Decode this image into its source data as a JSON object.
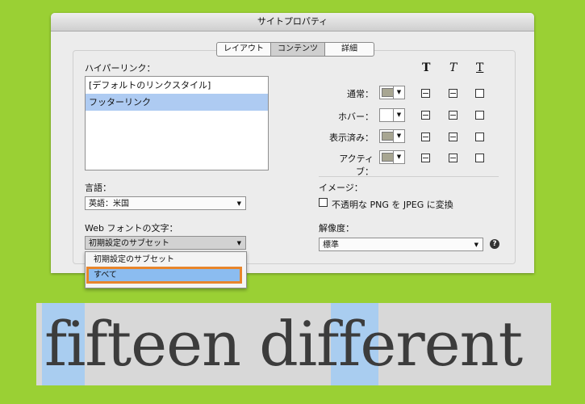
{
  "colors": {
    "background": "#9ad034",
    "highlight": "#a9cdf0",
    "focus_ring": "#e8852b"
  },
  "window": {
    "title": "サイトプロパティ"
  },
  "tabs": [
    "レイアウト",
    "コンテンツ",
    "詳細"
  ],
  "active_tab": "コンテンツ",
  "hyperlinks": {
    "label": "ハイパーリンク：",
    "items": [
      "[デフォルトのリンクスタイル]",
      "フッターリンク"
    ],
    "selected": "フッターリンク",
    "style_headers": [
      "T",
      "T",
      "T"
    ],
    "states": [
      {
        "label": "通常：",
        "color": "#a8a692"
      },
      {
        "label": "ホバー：",
        "color": "#ffffff"
      },
      {
        "label": "表示済み：",
        "color": "#a8a692"
      },
      {
        "label": "アクティブ：",
        "color": "#a8a692"
      }
    ]
  },
  "language": {
    "label": "言語：",
    "value": "英語：米国"
  },
  "image": {
    "label": "イメージ：",
    "checkbox_label": "不透明な PNG を JPEG に変換",
    "checked": false
  },
  "web_fonts": {
    "label": "Web フォントの文字：",
    "value": "初期設定のサブセット",
    "options": [
      "初期設定のサブセット",
      "すべて"
    ],
    "highlighted": "すべて"
  },
  "resolution": {
    "label": "解像度：",
    "value": "標準",
    "help": "?"
  },
  "font_demo": {
    "text": "fifteen different"
  }
}
